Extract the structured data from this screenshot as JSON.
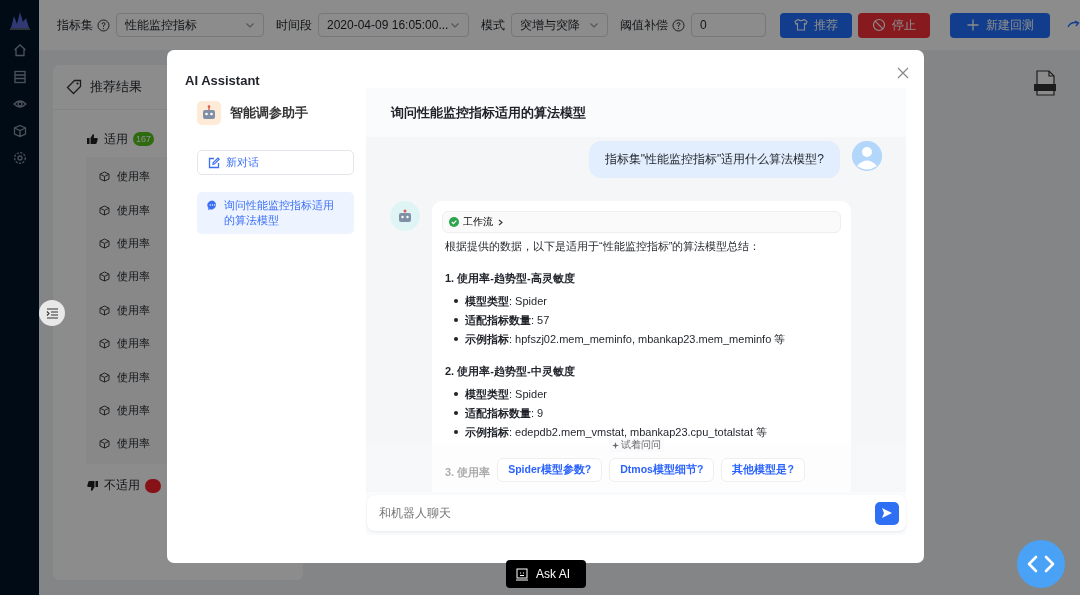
{
  "toolbar": {
    "fields": [
      {
        "label": "指标集",
        "help": true,
        "kind": "select",
        "value": "性能监控指标"
      },
      {
        "label": "时间段",
        "help": false,
        "kind": "select",
        "value": "2020-04-09 16:05:00..."
      },
      {
        "label": "模式",
        "help": false,
        "kind": "select",
        "value": "突增与突降"
      },
      {
        "label": "阈值补偿",
        "help": true,
        "kind": "input",
        "value": "0"
      }
    ],
    "buttons": [
      {
        "label": "推荐",
        "kind": "recommend"
      },
      {
        "label": "停止",
        "kind": "stop"
      },
      {
        "label": "新建回测",
        "kind": "create"
      }
    ]
  },
  "results": {
    "title": "推荐结果",
    "groups": [
      {
        "label": "适用",
        "kind": "good",
        "count": "167",
        "expanded": true,
        "items": [
          "使用率",
          "使用率",
          "使用率",
          "使用率",
          "使用率",
          "使用率",
          "使用率",
          "使用率",
          "使用率"
        ]
      },
      {
        "label": "不适用",
        "kind": "bad"
      }
    ]
  },
  "modal": {
    "title": "AI Assistant",
    "assistant_name": "智能调参助手",
    "new_chat": "新对话",
    "conversations": [
      {
        "title": "询问性能监控指标适用的算法模型",
        "selected": true
      }
    ],
    "chat": {
      "title": "询问性能监控指标适用的算法模型",
      "messages": [
        {
          "kind": "user",
          "text": "指标集\"性能监控指标\"适用什么算法模型?"
        },
        {
          "kind": "bot",
          "workflow": {
            "label": "工作流",
            "done": true
          },
          "intro": "根据提供的数据，以下是适用于“性能监控指标”的算法模型总结：",
          "sections": [
            {
              "heading": "1. 使用率-趋势型-高灵敏度",
              "items": [
                "**模型类型**: Spider",
                "**适配指标数量**: 57",
                "**示例指标**: hpfszj02.mem_meminfo, mbankap23.mem_meminfo 等"
              ]
            },
            {
              "heading": "2. 使用率-趋势型-中灵敏度",
              "items": [
                "**模型类型**: Spider",
                "**适配指标数量**: 9",
                "**示例指标**: edepdb2.mem_vmstat, mbankap23.cpu_totalstat 等"
              ]
            }
          ],
          "faded_heading": "3. 使用率"
        }
      ],
      "suggestions_label": "试着问问",
      "suggestions": [
        "Spider模型参数?",
        "Dtmos模型细节?",
        "其他模型是?"
      ],
      "input_placeholder": "和机器人聊天"
    }
  },
  "ask_ai": "Ask AI"
}
